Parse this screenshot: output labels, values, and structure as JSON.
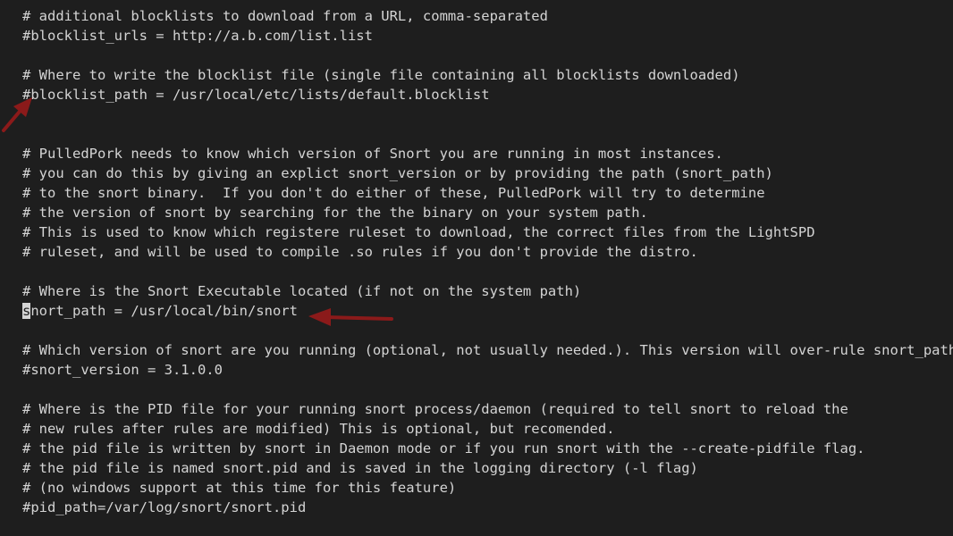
{
  "editor": {
    "background": "#1e1e1e",
    "text_color": "#d4d4d4",
    "annotation_color": "#8b1a1a",
    "lines": [
      "# additional blocklists to download from a URL, comma-separated",
      "#blocklist_urls = http://a.b.com/list.list",
      "",
      "# Where to write the blocklist file (single file containing all blocklists downloaded)",
      "#blocklist_path = /usr/local/etc/lists/default.blocklist",
      "",
      "",
      "# PulledPork needs to know which version of Snort you are running in most instances.",
      "# you can do this by giving an explict snort_version or by providing the path (snort_path)",
      "# to the snort binary.  If you don't do either of these, PulledPork will try to determine",
      "# the version of snort by searching for the the binary on your system path.",
      "# This is used to know which registere ruleset to download, the correct files from the LightSPD",
      "# ruleset, and will be used to compile .so rules if you don't provide the distro.",
      "",
      "# Where is the Snort Executable located (if not on the system path)",
      "snort_path = /usr/local/bin/snort",
      "",
      "# Which version of snort are you running (optional, not usually needed.). This version will over-rule snort_path",
      "#snort_version = 3.1.0.0",
      "",
      "# Where is the PID file for your running snort process/daemon (required to tell snort to reload the",
      "# new rules after rules are modified) This is optional, but recomended.",
      "# the pid file is written by snort in Daemon mode or if you run snort with the --create-pidfile flag.",
      "# the pid file is named snort.pid and is saved in the logging directory (-l flag)",
      "# (no windows support at this time for this feature)",
      "#pid_path=/var/log/snort/snort.pid"
    ],
    "cursor_line": 15,
    "cursor_char": "s",
    "cursor_line_rest": "nort_path = /usr/local/bin/snort"
  }
}
